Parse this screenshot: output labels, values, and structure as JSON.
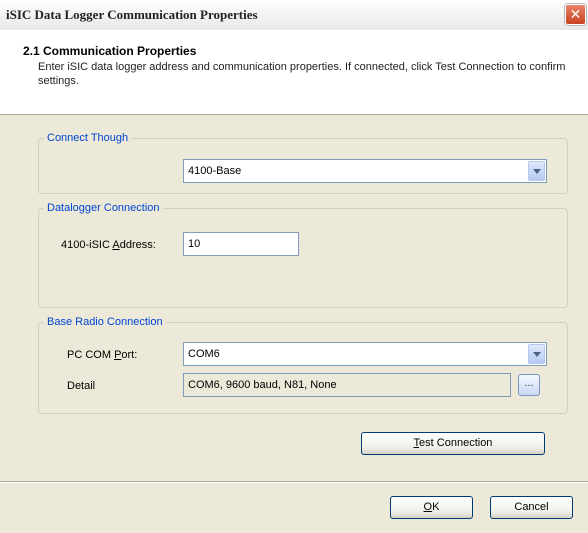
{
  "window": {
    "title": "iSIC Data Logger Communication Properties",
    "close_glyph": "✕"
  },
  "header": {
    "title": "2.1 Communication Properties",
    "description": "Enter iSIC data logger address and communication properties. If connected, click Test Connection to confirm settings."
  },
  "connect_through": {
    "legend": "Connect Though",
    "selected": "4100-Base"
  },
  "datalogger_connection": {
    "legend": "Datalogger Connection",
    "address_label_pre": "4100-iSIC ",
    "address_label_accel": "A",
    "address_label_post": "ddress:",
    "address_value": "10"
  },
  "base_radio_connection": {
    "legend": "Base Radio Connection",
    "com_port_label_pre": "PC COM ",
    "com_port_label_accel": "P",
    "com_port_label_post": "ort:",
    "com_port_value": "COM6",
    "detail_label": "Detail",
    "detail_value": "COM6, 9600 baud, N81, None",
    "detail_button": "..."
  },
  "buttons": {
    "test_accel": "T",
    "test_rest": "est Connection",
    "ok_accel": "O",
    "ok_rest": "K",
    "cancel": "Cancel"
  },
  "colors": {
    "group_legend": "#0046d5",
    "dialog_bg": "#ece9d8",
    "button_border": "#003c74"
  }
}
